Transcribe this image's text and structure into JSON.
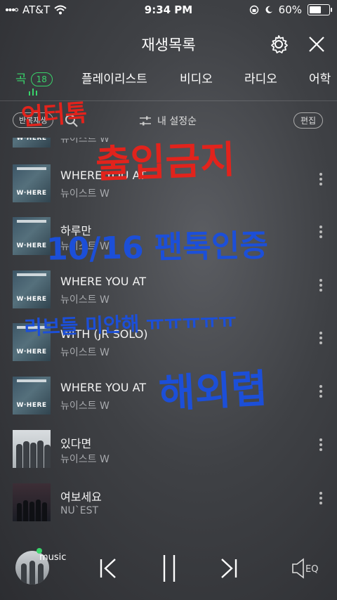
{
  "status_bar": {
    "carrier": "AT&T",
    "time": "9:34 PM",
    "battery": "60%",
    "battery_level": 0.6
  },
  "header": {
    "title": "재생목록"
  },
  "tabs": [
    {
      "label": "곡",
      "badge": "18"
    },
    {
      "label": "플레이리스트"
    },
    {
      "label": "비디오"
    },
    {
      "label": "라디오"
    },
    {
      "label": "어학"
    }
  ],
  "toolbar": {
    "repeat": "반복재생",
    "sort": "내 설정순",
    "edit": "편집"
  },
  "partial_row": {
    "artist": "뉴이스트 W"
  },
  "songs": [
    {
      "title": "WHERE YOU AT",
      "artist": "뉴이스트 W"
    },
    {
      "title": "하루만",
      "artist": "뉴이스트 W"
    },
    {
      "title": "WHERE YOU AT",
      "artist": "뉴이스트 W"
    },
    {
      "title": "WITH (JR SOLO)",
      "artist": "뉴이스트 W"
    },
    {
      "title": "WHERE YOU AT",
      "artist": "뉴이스트 W"
    },
    {
      "title": "있다면",
      "artist": "뉴이스트 W"
    },
    {
      "title": "여보세요",
      "artist": "NU`EST"
    }
  ],
  "album_text": "W·HERE",
  "overlays": {
    "red_1": "언터톡",
    "red_2": "출입금지",
    "blue_1": "10/16 팬톡인증",
    "blue_2": "리브들 미안해 ㅠㅠㅠㅠㅠ",
    "blue_3": "해외렵"
  },
  "player": {
    "label": "music"
  }
}
